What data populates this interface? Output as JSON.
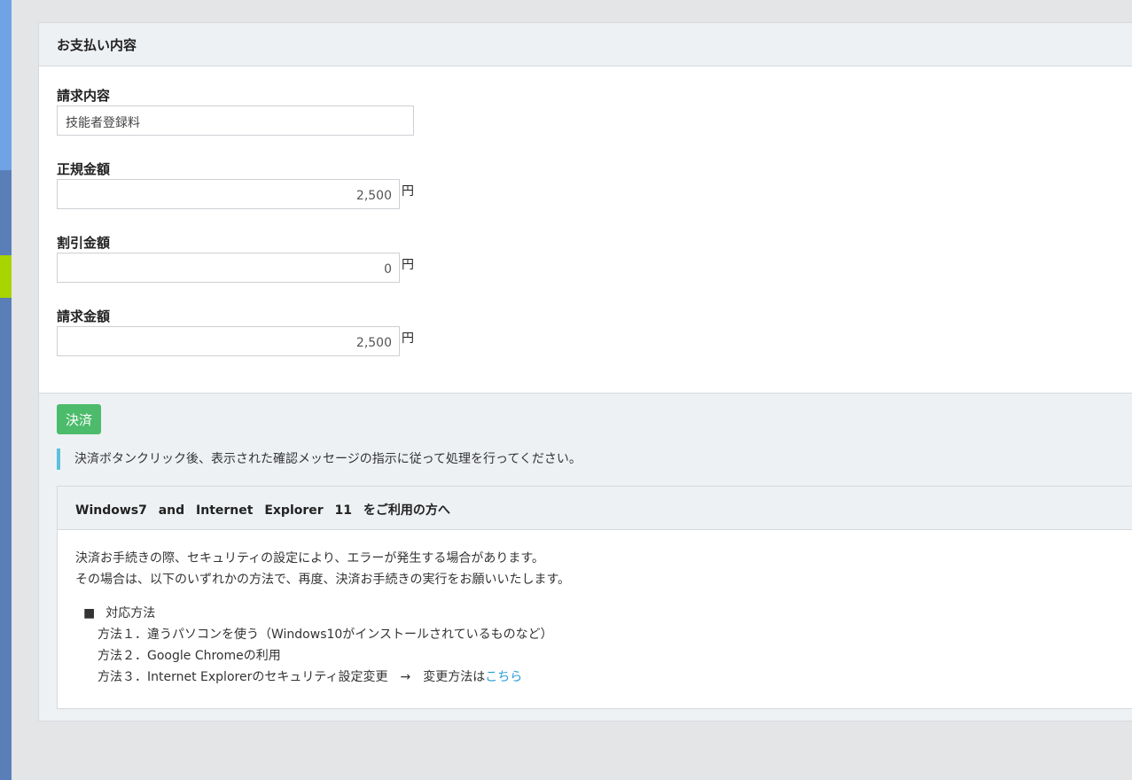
{
  "colors": {
    "pay_button": "#4cbb6b",
    "notice_border": "#5bc0de",
    "link": "#2b9ed8",
    "sidebar": "#5a7fb8",
    "sidebar_top": "#6fa3e6",
    "sidebar_accent": "#a8d400"
  },
  "card": {
    "title": "お支払い内容",
    "fields": {
      "invoice_label": "請求内容",
      "invoice_value": "技能者登録料",
      "regular_label": "正規金額",
      "regular_value": "2,500",
      "discount_label": "割引金額",
      "discount_value": "0",
      "billed_label": "請求金額",
      "billed_value": "2,500",
      "currency": "円"
    }
  },
  "footer": {
    "pay_button_label": "決済",
    "notice": "決済ボタンクリック後、表示された確認メッセージの指示に従って処理を行ってください。"
  },
  "ie_notice": {
    "title": "Windows7 and Internet Explorer 11 をご利用の方へ",
    "line1": "決済お手続きの際、セキュリティの設定により、エラーが発生する場合があります。",
    "line2": "その場合は、以下のいずれかの方法で、再度、決済お手続きの実行をお願いいたします。",
    "methods_bullet": "■",
    "methods_title": "対応方法",
    "method1": "方法１．違うパソコンを使う（Windows10がインストールされているものなど）",
    "method2": "方法２．Google Chromeの利用",
    "method3_text": "方法３．Internet Explorerのセキュリティ設定変更　→　変更方法は",
    "method3_link": "こちら"
  }
}
